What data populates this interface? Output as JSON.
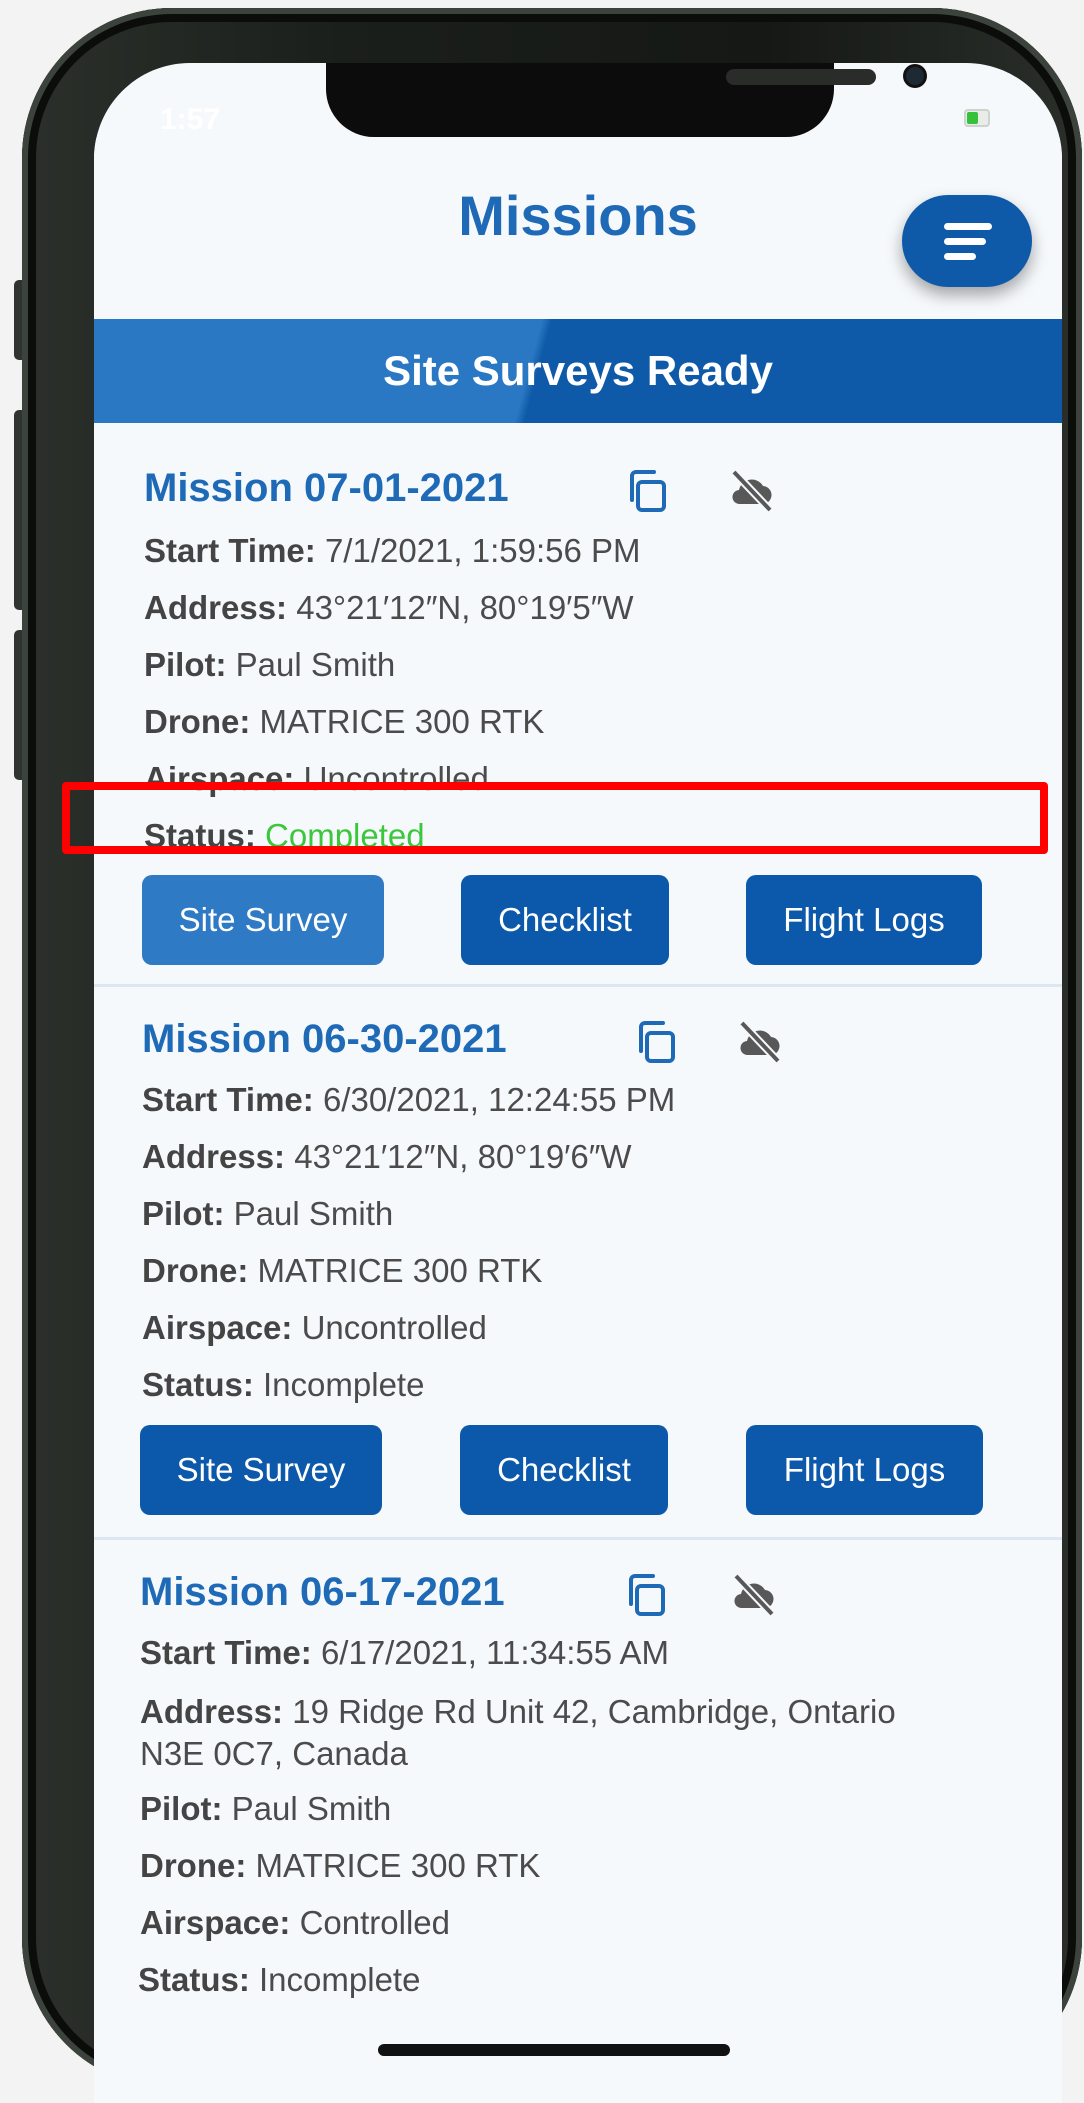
{
  "status_bar": {
    "time": "1:57"
  },
  "header": {
    "title": "Missions",
    "menu_icon": "hamburger-menu-icon"
  },
  "banner": {
    "text": "Site Surveys Ready"
  },
  "colors": {
    "primary": "#0f5aa8",
    "title_blue": "#1f6ab6",
    "completed_green": "#3cc63c",
    "highlight_red": "#ff0000"
  },
  "labels": {
    "start_time": "Start Time:",
    "address": "Address:",
    "pilot": "Pilot:",
    "drone": "Drone:",
    "airspace": "Airspace:",
    "status": "Status:"
  },
  "buttons": {
    "site_survey": "Site Survey",
    "checklist": "Checklist",
    "flight_logs": "Flight Logs"
  },
  "missions": [
    {
      "title": "Mission 07-01-2021",
      "start_time": "7/1/2021, 1:59:56 PM",
      "address": "43°21′12″N, 80°19′5″W",
      "pilot": "Paul Smith",
      "drone": "MATRICE 300 RTK",
      "airspace": "Uncontrolled",
      "status": "Completed"
    },
    {
      "title": "Mission 06-30-2021",
      "start_time": "6/30/2021, 12:24:55 PM",
      "address": "43°21′12″N, 80°19′6″W",
      "pilot": "Paul Smith",
      "drone": "MATRICE 300 RTK",
      "airspace": "Uncontrolled",
      "status": "Incomplete"
    },
    {
      "title": "Mission 06-17-2021",
      "start_time": "6/17/2021, 11:34:55 AM",
      "address_line1": "19 Ridge Rd Unit 42, Cambridge, Ontario",
      "address_line2": "N3E 0C7, Canada",
      "pilot": "Paul Smith",
      "drone": "MATRICE 300 RTK",
      "airspace": "Controlled",
      "status": "Incomplete"
    }
  ]
}
